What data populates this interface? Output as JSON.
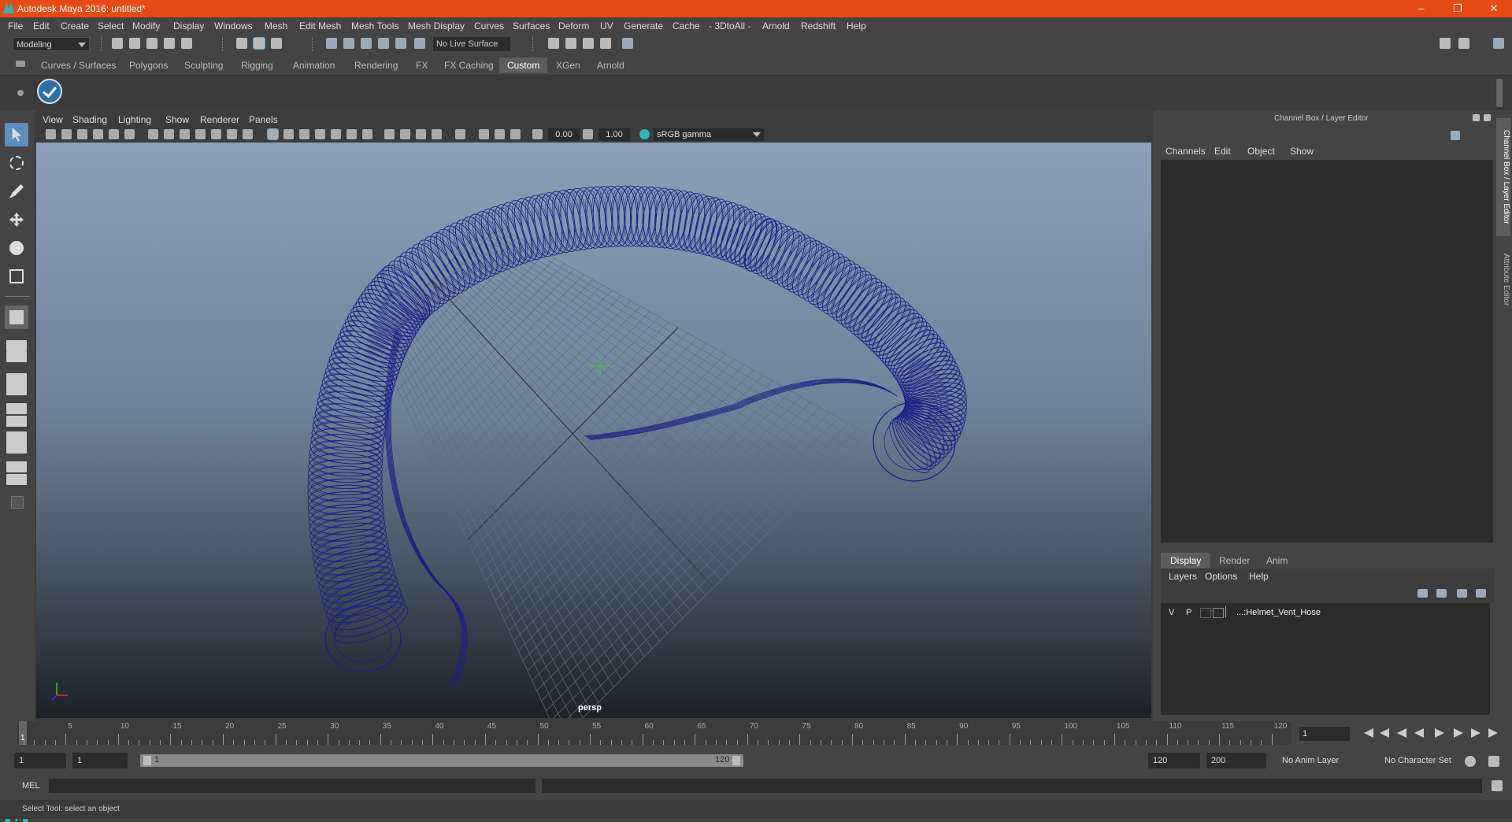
{
  "window": {
    "title": "Autodesk Maya 2016: untitled*",
    "controls": [
      "–",
      "❐",
      "✕"
    ]
  },
  "menubar": {
    "items": [
      "File",
      "Edit",
      "Create",
      "Select",
      "Modify",
      "Display",
      "Windows",
      "Mesh",
      "Edit Mesh",
      "Mesh Tools",
      "Mesh Display",
      "Curves",
      "Surfaces",
      "Deform",
      "UV",
      "Generate",
      "Cache",
      "- 3DtoAll -",
      "Arnold",
      "Redshift",
      "Help"
    ]
  },
  "statusline": {
    "mode": "Modeling",
    "live_surface": "No Live Surface"
  },
  "shelf": {
    "tabs": [
      "Curves / Surfaces",
      "Polygons",
      "Sculpting",
      "Rigging",
      "Animation",
      "Rendering",
      "FX",
      "FX Caching",
      "Custom",
      "XGen",
      "Arnold"
    ],
    "active_tab": "Custom"
  },
  "viewport": {
    "menu": [
      "View",
      "Shading",
      "Lighting",
      "Show",
      "Renderer",
      "Panels"
    ],
    "exposure": "0.00",
    "gamma": "1.00",
    "color_space": "sRGB gamma",
    "camera_label": "persp",
    "wire_color": "#1c1f86"
  },
  "channel_box": {
    "title": "Channel Box / Layer Editor",
    "menu": [
      "Channels",
      "Edit",
      "Object",
      "Show"
    ]
  },
  "layer_editor": {
    "tabs": [
      "Display",
      "Render",
      "Anim"
    ],
    "active_tab": "Display",
    "menu": [
      "Layers",
      "Options",
      "Help"
    ],
    "layers": [
      {
        "visible": "V",
        "playback": "P",
        "name": "...:Helmet_Vent_Hose"
      }
    ]
  },
  "side_tabs": [
    "Channel Box / Layer Editor",
    "Attribute Editor"
  ],
  "time_slider": {
    "ticks": [
      "5",
      "10",
      "15",
      "20",
      "25",
      "30",
      "35",
      "40",
      "45",
      "50",
      "55",
      "60",
      "65",
      "70",
      "75",
      "80",
      "85",
      "90",
      "95",
      "100",
      "105",
      "110",
      "115",
      "120"
    ],
    "start_label": "1",
    "current_frame": "1"
  },
  "range": {
    "start": "1",
    "playback_start": "1",
    "range_start": "1",
    "range_end": "120",
    "playback_end": "120",
    "end": "200",
    "anim_layer": "No Anim Layer",
    "character_set": "No Character Set"
  },
  "command_line": {
    "label": "MEL"
  },
  "help_line": {
    "text": "Select Tool: select an object"
  }
}
